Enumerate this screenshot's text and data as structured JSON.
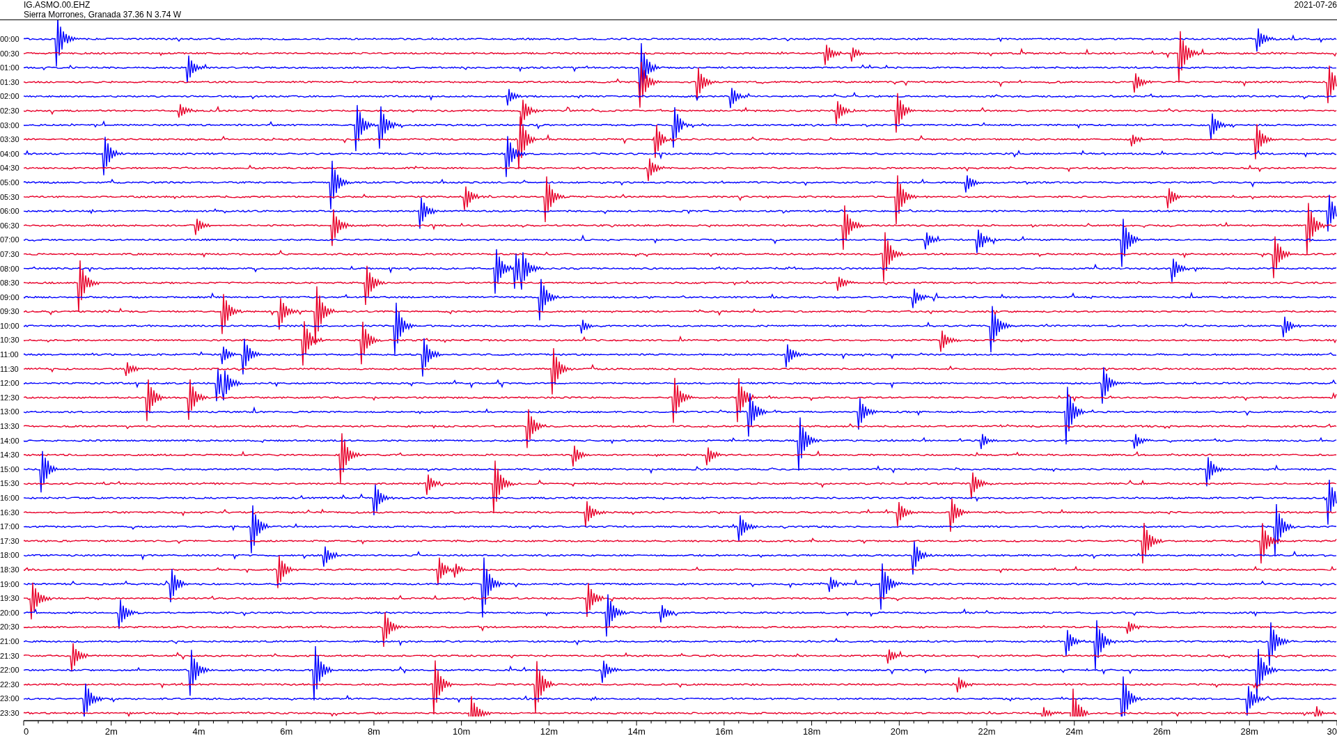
{
  "header": {
    "station": "IG.ASMO.00.EHZ",
    "location": "Sierra Morrones, Granada  37.36 N 3.74 W",
    "date": "2021-07-26"
  },
  "rows": [
    {
      "time": "00:00",
      "color": "#0000ff"
    },
    {
      "time": "00:30",
      "color": "#e8002a"
    },
    {
      "time": "01:00",
      "color": "#0000ff"
    },
    {
      "time": "01:30",
      "color": "#e8002a"
    },
    {
      "time": "02:00",
      "color": "#0000ff"
    },
    {
      "time": "02:30",
      "color": "#e8002a"
    },
    {
      "time": "03:00",
      "color": "#0000ff"
    },
    {
      "time": "03:30",
      "color": "#e8002a"
    },
    {
      "time": "04:00",
      "color": "#0000ff"
    },
    {
      "time": "04:30",
      "color": "#e8002a"
    },
    {
      "time": "05:00",
      "color": "#0000ff"
    },
    {
      "time": "05:30",
      "color": "#e8002a"
    },
    {
      "time": "06:00",
      "color": "#0000ff"
    },
    {
      "time": "06:30",
      "color": "#e8002a"
    },
    {
      "time": "07:00",
      "color": "#0000ff"
    },
    {
      "time": "07:30",
      "color": "#e8002a"
    },
    {
      "time": "08:00",
      "color": "#0000ff"
    },
    {
      "time": "08:30",
      "color": "#e8002a"
    },
    {
      "time": "09:00",
      "color": "#0000ff"
    },
    {
      "time": "09:30",
      "color": "#e8002a"
    },
    {
      "time": "10:00",
      "color": "#0000ff"
    },
    {
      "time": "10:30",
      "color": "#e8002a"
    },
    {
      "time": "11:00",
      "color": "#0000ff"
    },
    {
      "time": "11:30",
      "color": "#e8002a"
    },
    {
      "time": "12:00",
      "color": "#0000ff"
    },
    {
      "time": "12:30",
      "color": "#e8002a"
    },
    {
      "time": "13:00",
      "color": "#0000ff"
    },
    {
      "time": "13:30",
      "color": "#e8002a"
    },
    {
      "time": "14:00",
      "color": "#0000ff"
    },
    {
      "time": "14:30",
      "color": "#e8002a"
    },
    {
      "time": "15:00",
      "color": "#0000ff"
    },
    {
      "time": "15:30",
      "color": "#e8002a"
    },
    {
      "time": "16:00",
      "color": "#0000ff"
    },
    {
      "time": "16:30",
      "color": "#e8002a"
    },
    {
      "time": "17:00",
      "color": "#0000ff"
    },
    {
      "time": "17:30",
      "color": "#e8002a"
    },
    {
      "time": "18:00",
      "color": "#0000ff"
    },
    {
      "time": "18:30",
      "color": "#e8002a"
    },
    {
      "time": "19:00",
      "color": "#0000ff"
    },
    {
      "time": "19:30",
      "color": "#e8002a"
    },
    {
      "time": "20:00",
      "color": "#0000ff"
    },
    {
      "time": "20:30",
      "color": "#e8002a"
    },
    {
      "time": "21:00",
      "color": "#0000ff"
    },
    {
      "time": "21:30",
      "color": "#e8002a"
    },
    {
      "time": "22:00",
      "color": "#0000ff"
    },
    {
      "time": "22:30",
      "color": "#e8002a"
    },
    {
      "time": "23:00",
      "color": "#0000ff"
    },
    {
      "time": "23:30",
      "color": "#e8002a"
    }
  ],
  "x_axis": [
    "0",
    "2m",
    "4m",
    "6m",
    "8m",
    "10m",
    "12m",
    "14m",
    "16m",
    "18m",
    "20m",
    "22m",
    "24m",
    "26m",
    "28m",
    "30"
  ]
}
